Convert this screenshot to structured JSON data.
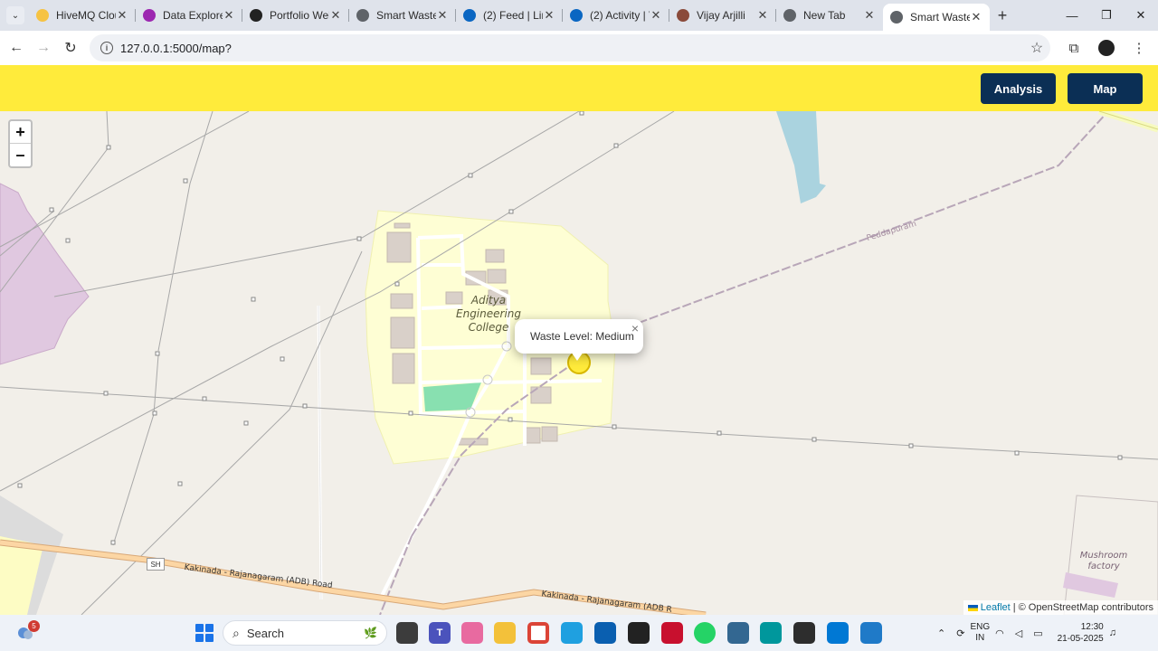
{
  "browser": {
    "tabs": [
      {
        "title": "HiveMQ Clou",
        "color": "#f6c343"
      },
      {
        "title": "Data Explorer",
        "color": "#9c27b0"
      },
      {
        "title": "Portfolio Web",
        "color": "#222222"
      },
      {
        "title": "Smart Waste",
        "color": "#5f6368"
      },
      {
        "title": "(2) Feed | Link",
        "color": "#0a66c2"
      },
      {
        "title": "(2) Activity | V",
        "color": "#0a66c2"
      },
      {
        "title": "Vijay Arjilli",
        "color": "#8a4a3a"
      },
      {
        "title": "New Tab",
        "color": "#5f6368"
      },
      {
        "title": "Smart Waste",
        "color": "#5f6368"
      }
    ],
    "url": "127.0.0.1:5000/map?"
  },
  "header": {
    "analysis_label": "Analysis",
    "map_label": "Map",
    "bg_color": "#ffeb3b",
    "button_color": "#0b2f55"
  },
  "map": {
    "zoom_in": "+",
    "zoom_out": "–",
    "college_label_1": "Aditya",
    "college_label_2": "Engineering",
    "college_label_3": "College",
    "village_label": "Peddapuram",
    "mushroom_label_1": "Mushroom",
    "mushroom_label_2": "factory",
    "road_label_1": "Kakinada - Rajanagaram (ADB) Road",
    "road_label_2": "Kakinada - Rajanagaram (ADB R",
    "shield_label": "SH",
    "popup_text": "Waste Level: Medium",
    "popup_close": "×",
    "attribution_leaflet": "Leaflet",
    "attribution_rest": "| © OpenStreetMap contributors"
  },
  "taskbar": {
    "weather_badge": "5",
    "search_placeholder": "Search",
    "lang_1": "ENG",
    "lang_2": "IN",
    "time": "12:30",
    "date": "21-05-2025"
  }
}
